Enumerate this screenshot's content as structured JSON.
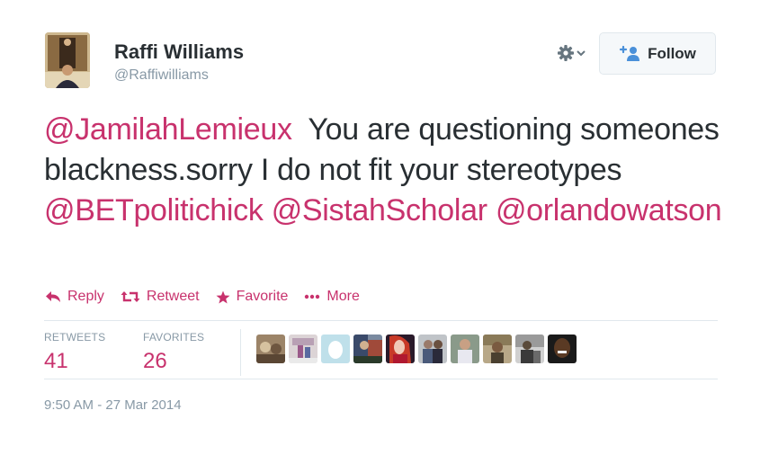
{
  "user": {
    "name": "Raffi Williams",
    "handle": "@Raffiwilliams"
  },
  "follow": {
    "label": "Follow"
  },
  "tweet": {
    "segments": [
      {
        "text": "@JamilahLemieux",
        "mention": true
      },
      {
        "text": "  You are questioning someones blackness.sorry I do not fit your stereotypes ",
        "mention": false
      },
      {
        "text": "@BETpolitichick",
        "mention": true
      },
      {
        "text": " ",
        "mention": false
      },
      {
        "text": "@SistahScholar",
        "mention": true
      },
      {
        "text": " ",
        "mention": false
      },
      {
        "text": "@orlandowatson",
        "mention": true
      }
    ]
  },
  "actions": {
    "reply": "Reply",
    "retweet": "Retweet",
    "favorite": "Favorite",
    "more": "More"
  },
  "stats": {
    "retweets_label": "RETWEETS",
    "retweets_value": "41",
    "favorites_label": "FAVORITES",
    "favorites_value": "26"
  },
  "timestamp": "9:50 AM - 27 Mar 2014",
  "colors": {
    "accent": "#c8326d",
    "text": "#292f33",
    "muted": "#8899a6",
    "border": "#e1e8ed"
  }
}
